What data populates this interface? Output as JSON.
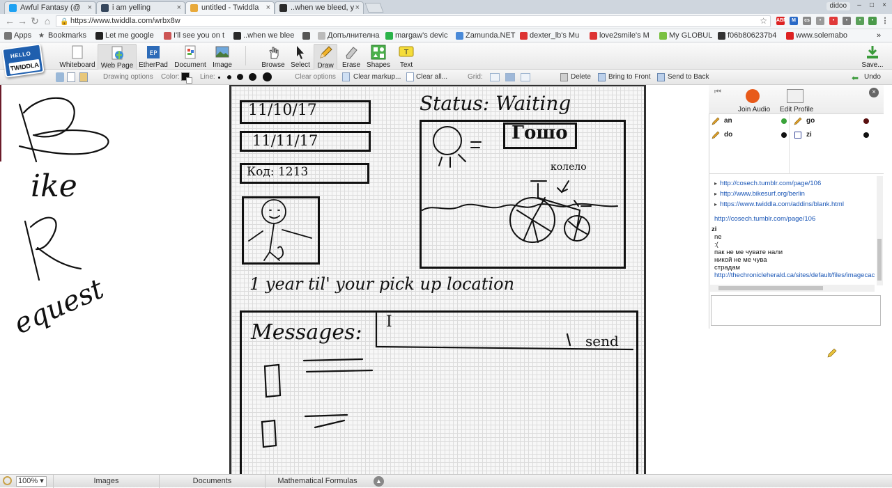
{
  "browser": {
    "tabs": [
      {
        "title": "Awful Fantasy (@",
        "icon": "twitter-icon",
        "color": "#1da1f2",
        "active": false
      },
      {
        "title": "i am yelling",
        "icon": "tumblr-icon",
        "color": "#35465c",
        "active": false
      },
      {
        "title": "untitled - Twiddla",
        "icon": "twiddla-icon",
        "color": "#e8a93a",
        "active": true
      },
      {
        "title": "..when we bleed, y",
        "icon": "page-icon",
        "color": "#2a2a2a",
        "active": false
      }
    ],
    "profile_name": "didoo",
    "url": "https://www.twiddla.com/wrbx8w",
    "bookmarks": [
      "Apps",
      "Bookmarks",
      "Let me google",
      "I'll see you on t",
      "..when we blee",
      "",
      "Допълнителна",
      "margaw's devic",
      "Zamunda.NET",
      "dexter_lb's Mu",
      "love2smile's M",
      "My GLOBUL",
      "f06b806237b4",
      "www.solemabo"
    ]
  },
  "toolbar": {
    "logo_hello": "HELLO",
    "logo_name": "TWIDDLA",
    "buttons": [
      "Whiteboard",
      "Web Page",
      "EtherPad",
      "Document",
      "Image",
      "Browse",
      "Select",
      "Draw",
      "Erase",
      "Shapes",
      "Text",
      "Save..."
    ],
    "etherpad_mark": "EP",
    "text_mark": "T"
  },
  "options": {
    "drawing_options": "Drawing options",
    "color_label": "Color:",
    "line_label": "Line:",
    "clear_options": "Clear options",
    "clear_markup": "Clear markup...",
    "clear_all": "Clear all...",
    "grid_label": "Grid:",
    "delete": "Delete",
    "bring_front": "Bring to Front",
    "send_back": "Send to Back",
    "undo": "Undo",
    "color_value": "#111111"
  },
  "canvas": {
    "date1": "11/10/17",
    "date2": "11/11/17",
    "code": "Код: 1213",
    "status": "Status: Waiting",
    "name": "Гошо",
    "bike_label": "колело",
    "pickup": "1 year til' your pick up location",
    "messages": "Messages:",
    "cursor": "I",
    "send": "send"
  },
  "left_handwriting": [
    "B",
    "ike",
    "R",
    "equest"
  ],
  "panel": {
    "join_audio": "Join Audio",
    "edit_profile": "Edit Profile",
    "users": [
      {
        "name": "an",
        "status_color": "#3aa33a"
      },
      {
        "name": "do",
        "status_color": "#111111"
      },
      {
        "name": "go",
        "status_color": "#5a1010"
      },
      {
        "name": "zi",
        "status_color": "#111111"
      }
    ],
    "links": [
      "http://cosech.tumblr.com/page/106",
      "http://www.bikesurf.org/berlin",
      "https://www.twiddla.com/addins/blank.html",
      "http://cosech.tumblr.com/page/106"
    ],
    "chat_user": "zi",
    "chat_lines": [
      "ne",
      ":(",
      "пак не ме чувате нали",
      "никой не ме чува",
      "страдам"
    ],
    "chat_link": "http://thechronicleherald.ca/sites/default/files/imagecac"
  },
  "status": {
    "zoom": "100%",
    "tabs": [
      "Images",
      "Documents",
      "Mathematical Formulas"
    ]
  }
}
